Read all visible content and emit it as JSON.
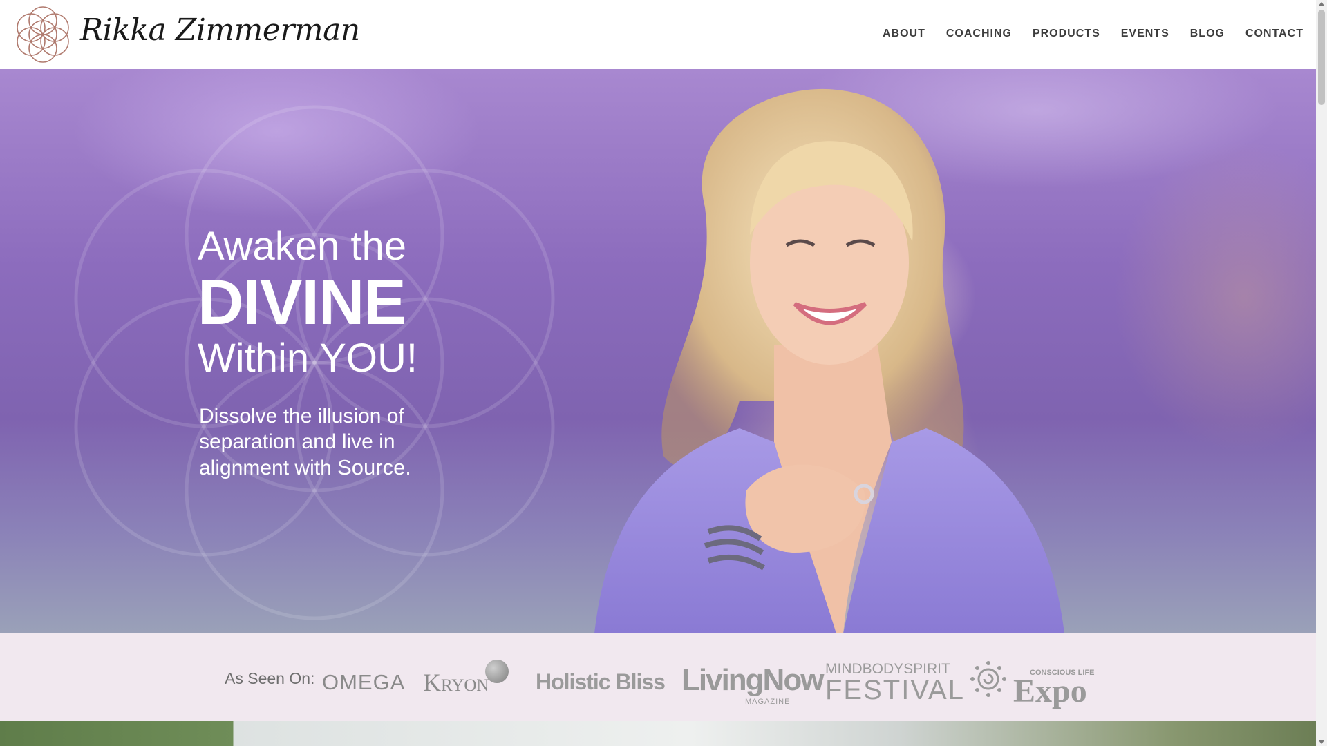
{
  "site": {
    "name": "Rikka Zimmerman",
    "logo_icon": "flower-of-life-logo-icon"
  },
  "nav": {
    "items": [
      {
        "label": "ABOUT"
      },
      {
        "label": "COACHING"
      },
      {
        "label": "PRODUCTS"
      },
      {
        "label": "EVENTS"
      },
      {
        "label": "BLOG"
      },
      {
        "label": "CONTACT"
      }
    ]
  },
  "hero": {
    "headline_1": "Awaken the",
    "headline_2": "DIVINE",
    "headline_3": "Within YOU!",
    "tagline_text": "Dissolve the illusion of separation and live in alignment with ",
    "tagline_emphasis": "Source",
    "tagline_end": "."
  },
  "as_seen_on": {
    "label": "As Seen On:",
    "brands": {
      "omega": "OMEGA",
      "kryon": "Kryon",
      "holistic": "Holistic Bliss",
      "holistic_sub": "",
      "living_now": "LivingNow",
      "living_now_sub": "MAGAZINE",
      "mbs_1": "MINDBODYSPIRIT",
      "mbs_2": "FESTIVAL",
      "expo_sub": "CONSCIOUS LIFE",
      "expo": "Expo"
    }
  },
  "colors": {
    "hero_purple": "#8c6cbd",
    "seen_bg": "#f1e8ef",
    "logo_rose": "#b07a6e",
    "nav_text": "#3d3d3d"
  }
}
